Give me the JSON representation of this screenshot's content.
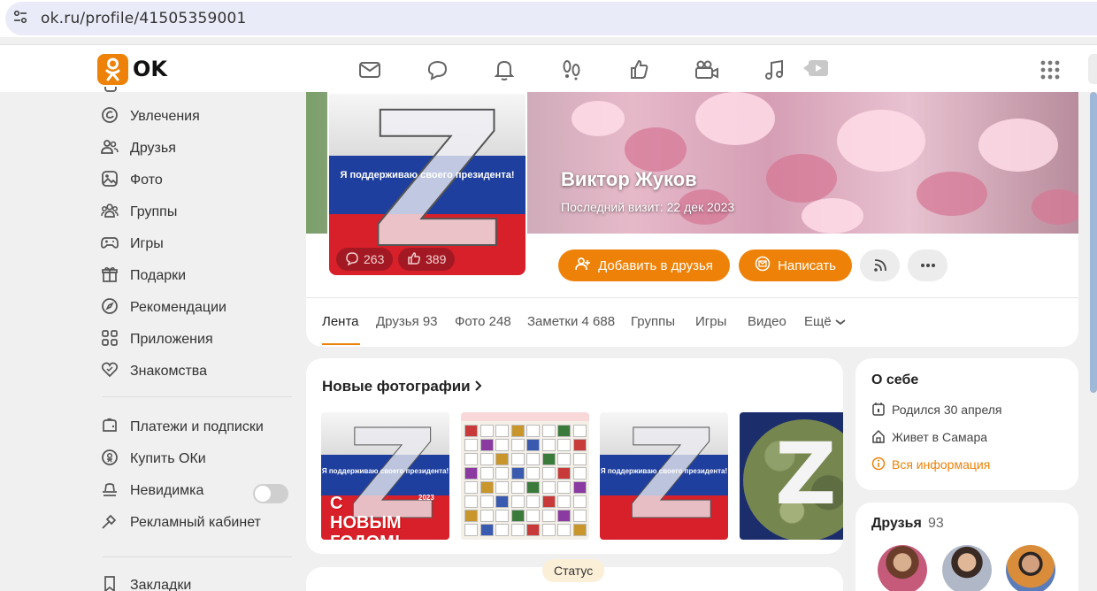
{
  "browser": {
    "url": "ok.ru/profile/41505359001"
  },
  "header": {
    "logo_text": "OK",
    "brand_color": "#ee8208",
    "nav_icons": [
      "mail-icon",
      "chat-icon",
      "bell-icon",
      "guests-icon",
      "like-icon",
      "video-camera-icon",
      "music-icon",
      "video-icon"
    ]
  },
  "sidebar": {
    "items": [
      {
        "label": "Увлечения",
        "icon": "hobby-icon"
      },
      {
        "label": "Друзья",
        "icon": "friends-icon"
      },
      {
        "label": "Фото",
        "icon": "photo-icon"
      },
      {
        "label": "Группы",
        "icon": "groups-icon"
      },
      {
        "label": "Игры",
        "icon": "gamepad-icon"
      },
      {
        "label": "Подарки",
        "icon": "gift-icon"
      },
      {
        "label": "Рекомендации",
        "icon": "compass-icon"
      },
      {
        "label": "Приложения",
        "icon": "apps-grid-icon"
      },
      {
        "label": "Знакомства",
        "icon": "dating-icon"
      }
    ],
    "items2": [
      {
        "label": "Платежи и подписки",
        "icon": "wallet-icon"
      },
      {
        "label": "Купить ОКи",
        "icon": "coin-icon"
      },
      {
        "label": "Невидимка",
        "icon": "incognito-icon",
        "toggle": false
      },
      {
        "label": "Рекламный кабинет",
        "icon": "ads-icon"
      }
    ],
    "items3": [
      {
        "label": "Закладки",
        "icon": "bookmark-icon"
      }
    ]
  },
  "profile": {
    "name": "Виктор Жуков",
    "last_visit": "Последний визит: 22 дек 2023",
    "avatar_caption": "Я поддерживаю своего президента!",
    "avatar_letter": "Z",
    "comments_count": "263",
    "likes_count": "389",
    "add_friend_label": "Добавить в друзья",
    "write_label": "Написать"
  },
  "tabs": [
    {
      "label": "Лента",
      "active": true
    },
    {
      "label": "Друзья 93"
    },
    {
      "label": "Фото 248"
    },
    {
      "label": "Заметки 4 688"
    },
    {
      "label": "Группы"
    },
    {
      "label": "Игры"
    },
    {
      "label": "Видео"
    },
    {
      "label": "Ещё"
    }
  ],
  "new_photos": {
    "title": "Новые фотографии",
    "thumb_caption": "Я поддерживаю своего президента!",
    "new_year_text": "С НОВЫМ ГОДОМ!",
    "year": "2023"
  },
  "status_label": "Статус",
  "about": {
    "title": "О себе",
    "born": "Родился 30 апреля",
    "lives": "Живет в Самара",
    "all_info": "Вся информация"
  },
  "friends": {
    "title": "Друзья",
    "count": "93"
  }
}
